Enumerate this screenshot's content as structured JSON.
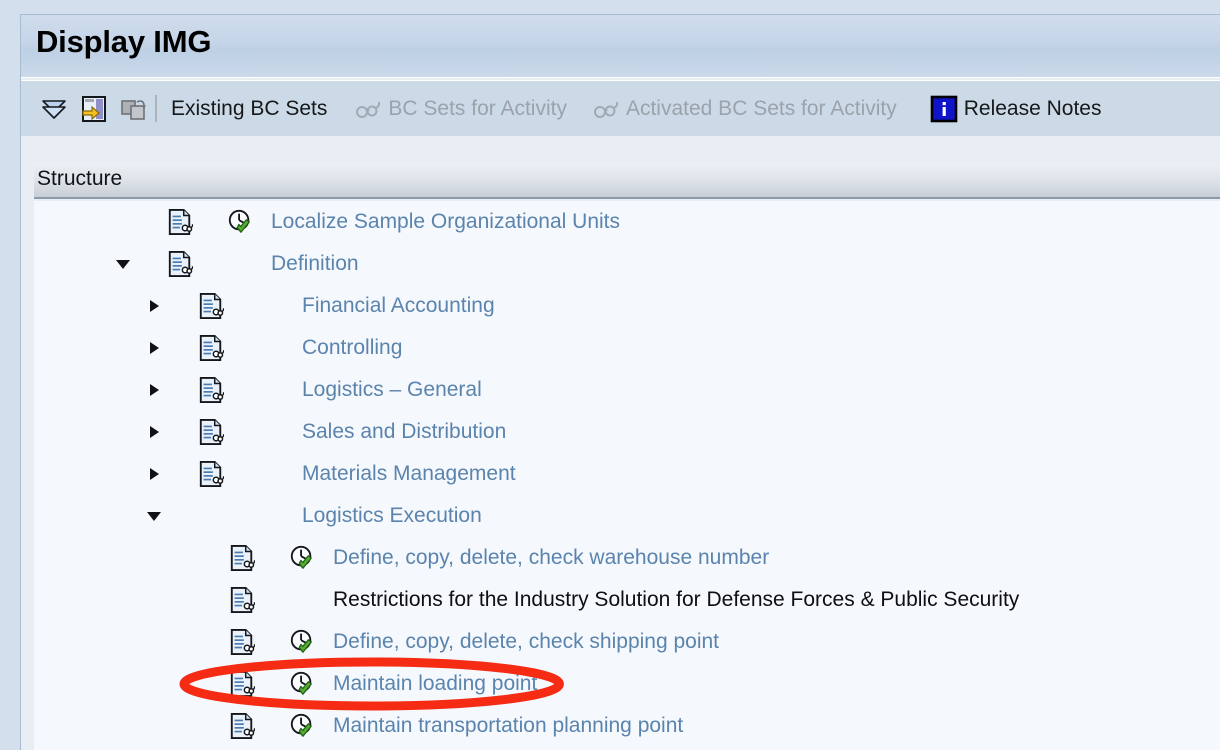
{
  "window": {
    "title": "Display IMG"
  },
  "toolbar": {
    "items": [
      {
        "id": "collapse-all",
        "icon": "collapse-all-icon",
        "label": "",
        "enabled": true
      },
      {
        "id": "display-node",
        "icon": "document-arrow-icon",
        "label": "",
        "enabled": true
      },
      {
        "id": "copy-node",
        "icon": "copy-icon",
        "label": "",
        "enabled": false
      },
      {
        "id": "separator",
        "icon": "separator",
        "label": "",
        "enabled": false
      },
      {
        "id": "existing-bc-sets",
        "icon": "",
        "label": "Existing BC Sets",
        "enabled": true
      },
      {
        "id": "bc-sets-for-activity",
        "icon": "glasses-icon",
        "label": "BC Sets for Activity",
        "enabled": false
      },
      {
        "id": "activated-bc-sets-for-activity",
        "icon": "glasses-icon",
        "label": "Activated BC Sets for Activity",
        "enabled": false
      },
      {
        "id": "release-notes",
        "icon": "info-icon",
        "label": "Release Notes",
        "enabled": true
      }
    ]
  },
  "structure": {
    "header": "Structure",
    "rows": [
      {
        "label": "Localize Sample Organizational Units",
        "indent": 0,
        "arrow": "none",
        "doc": true,
        "clock": true,
        "color": "link"
      },
      {
        "label": "Definition",
        "indent": 0,
        "arrow": "down",
        "doc": true,
        "clock": false,
        "color": "link"
      },
      {
        "label": "Financial Accounting",
        "indent": 1,
        "arrow": "right",
        "doc": true,
        "clock": false,
        "color": "link"
      },
      {
        "label": "Controlling",
        "indent": 1,
        "arrow": "right",
        "doc": true,
        "clock": false,
        "color": "link"
      },
      {
        "label": "Logistics – General",
        "indent": 1,
        "arrow": "right",
        "doc": true,
        "clock": false,
        "color": "link"
      },
      {
        "label": "Sales and Distribution",
        "indent": 1,
        "arrow": "right",
        "doc": true,
        "clock": false,
        "color": "link"
      },
      {
        "label": "Materials Management",
        "indent": 1,
        "arrow": "right",
        "doc": true,
        "clock": false,
        "color": "link"
      },
      {
        "label": "Logistics Execution",
        "indent": 1,
        "arrow": "down",
        "doc": false,
        "clock": false,
        "color": "link"
      },
      {
        "label": "Define, copy, delete, check warehouse number",
        "indent": 2,
        "arrow": "none",
        "doc": true,
        "clock": true,
        "color": "link"
      },
      {
        "label": "Restrictions for the Industry Solution for Defense Forces & Public Security",
        "indent": 2,
        "arrow": "none",
        "doc": true,
        "clock": false,
        "color": "black"
      },
      {
        "label": "Define, copy, delete, check shipping point",
        "indent": 2,
        "arrow": "none",
        "doc": true,
        "clock": true,
        "color": "link"
      },
      {
        "label": "Maintain loading point",
        "indent": 2,
        "arrow": "none",
        "doc": true,
        "clock": true,
        "color": "link"
      },
      {
        "label": "Maintain transportation planning point",
        "indent": 2,
        "arrow": "none",
        "doc": true,
        "clock": true,
        "color": "link"
      }
    ]
  },
  "annotation": {
    "target_row_index": 11,
    "shape": "ellipse",
    "color": "#f52b14"
  },
  "colors": {
    "link": "#5b84ad",
    "text": "#0d0f12",
    "annotation": "#f52b14",
    "titlebar": "#c6d5e8",
    "toolbar": "#ccdae8",
    "tree_bg": "#f5f8fd"
  }
}
